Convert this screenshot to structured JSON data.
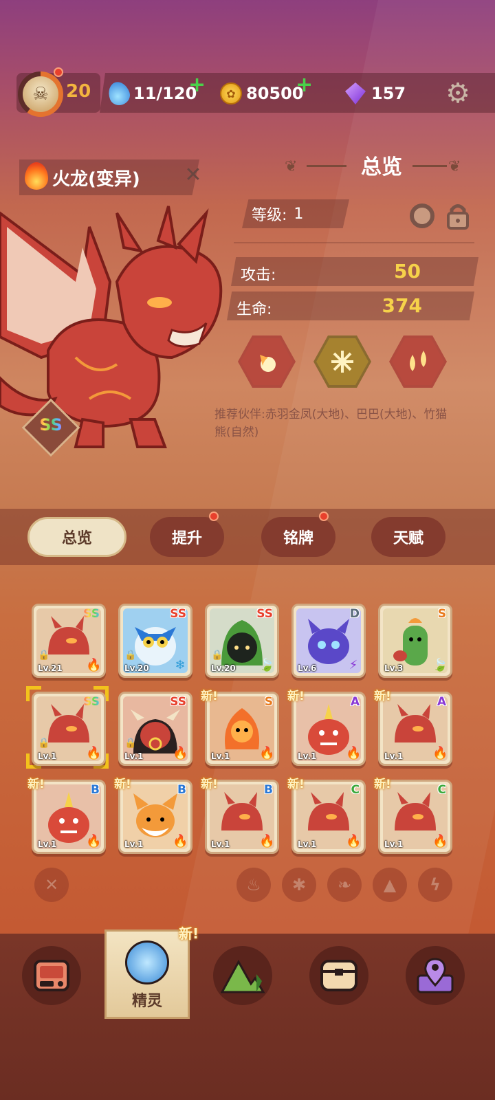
{
  "topbar": {
    "level": "20",
    "stamina": "11/120",
    "coins": "80500",
    "gems": "157"
  },
  "pet": {
    "name": "火龙(变异)",
    "rank": "SS",
    "level_label": "等级:",
    "level_value": "1"
  },
  "overview": {
    "title": "总览",
    "attack_label": "攻击:",
    "attack_value": "50",
    "hp_label": "生命:",
    "hp_value": "374",
    "recommend": "推荐伙伴:赤羽金凤(大地)、巴巴(大地)、竹猫熊(自然)"
  },
  "tabs": [
    "总览",
    "提升",
    "铭牌",
    "天赋"
  ],
  "grid": [
    {
      "rank": "SS",
      "level": "Lv.21",
      "new": ""
    },
    {
      "rank": "SS",
      "level": "Lv.20",
      "new": ""
    },
    {
      "rank": "SS",
      "level": "Lv.20",
      "new": ""
    },
    {
      "rank": "D",
      "level": "Lv.6",
      "new": ""
    },
    {
      "rank": "S",
      "level": "Lv.3",
      "new": ""
    },
    {
      "rank": "SS",
      "level": "Lv.1",
      "new": ""
    },
    {
      "rank": "SS",
      "level": "Lv.1",
      "new": ""
    },
    {
      "rank": "S",
      "level": "Lv.1",
      "new": "新!"
    },
    {
      "rank": "A",
      "level": "Lv.1",
      "new": "新!"
    },
    {
      "rank": "A",
      "level": "Lv.1",
      "new": "新!"
    },
    {
      "rank": "B",
      "level": "Lv.1",
      "new": "新!"
    },
    {
      "rank": "B",
      "level": "Lv.1",
      "new": "新!"
    },
    {
      "rank": "B",
      "level": "Lv.1",
      "new": "新!"
    },
    {
      "rank": "C",
      "level": "Lv.1",
      "new": "新!"
    },
    {
      "rank": "C",
      "level": "Lv.1",
      "new": "新!"
    }
  ],
  "bottom_nav": {
    "new_badge": "新!",
    "active_label": "精灵"
  },
  "colors": {
    "rank_ss": "#e8402c",
    "rank_s": "#e87a1c",
    "rank_a": "#8a3ad6",
    "rank_b": "#2a78d6",
    "rank_c": "#3aa83a",
    "rank_d": "#5a6b7a",
    "stat_value": "#f6d24a"
  },
  "icons": {
    "resources": [
      "water-drop-icon",
      "paw-coin-icon",
      "purple-gem-icon"
    ],
    "skills": [
      "fireball-skill-icon",
      "crossed-claws-skill-icon",
      "twin-flame-skill-icon"
    ],
    "filters": [
      "clear-filter-icon",
      "fire-element-icon",
      "ice-element-icon",
      "nature-element-icon",
      "earth-element-icon",
      "lightning-element-icon"
    ],
    "bottom_nav": [
      "console-icon",
      "pet-orb-icon",
      "mountain-icon",
      "chest-icon",
      "map-pin-icon"
    ]
  }
}
